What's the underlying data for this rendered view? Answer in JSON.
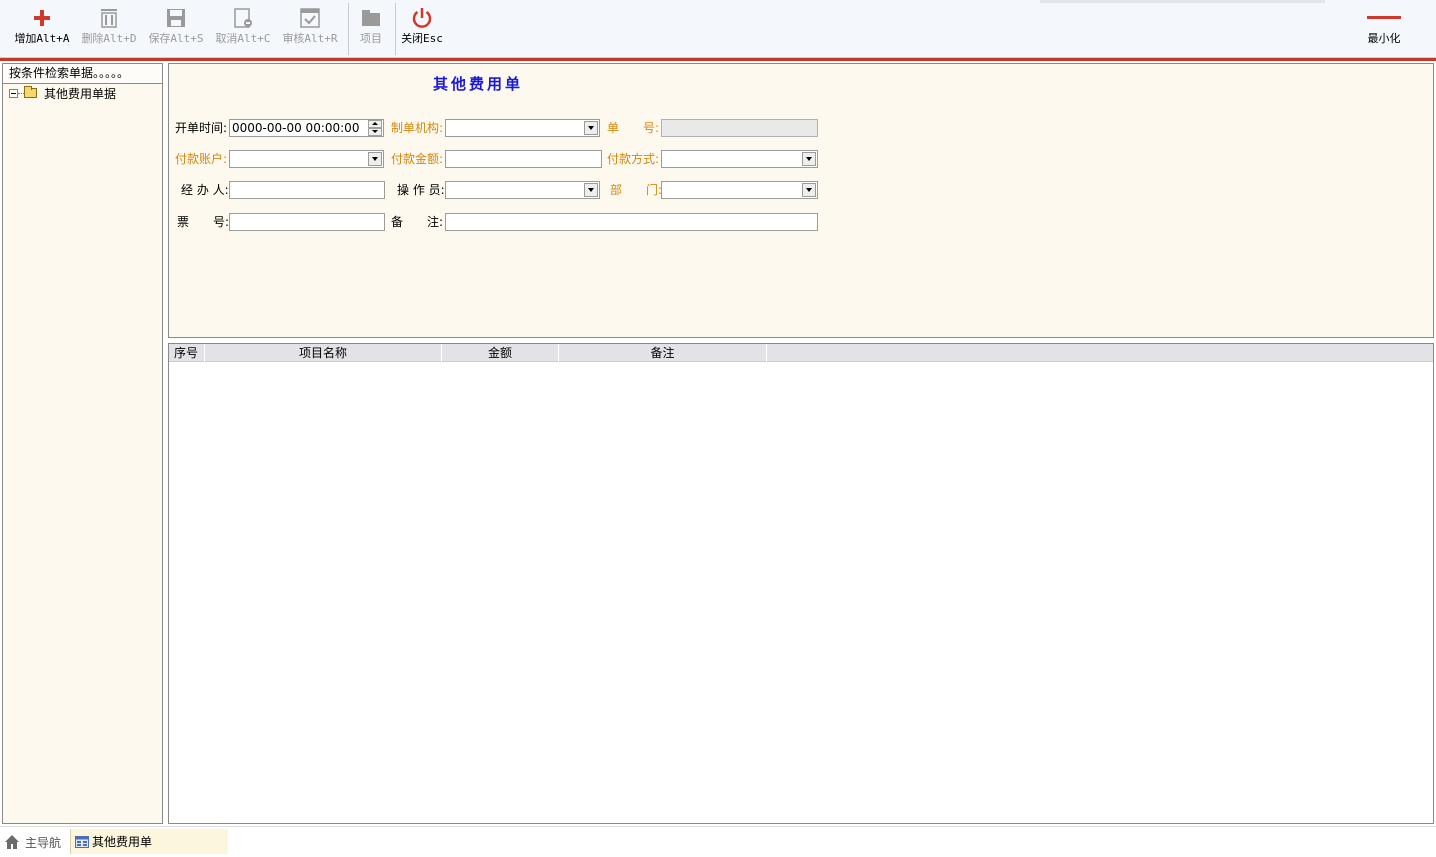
{
  "toolbar": {
    "add": "增加Alt+A",
    "delete": "删除Alt+D",
    "save": "保存Alt+S",
    "cancel": "取消Alt+C",
    "approve": "审核Alt+R",
    "items": "项目",
    "close": "关闭Esc",
    "minimize": "最小化"
  },
  "left_panel": {
    "header": "按条件检索单据。。。。。",
    "tree_root": "其他费用单据"
  },
  "form": {
    "title": "其他费用单",
    "open_time_label": "开单时间:",
    "open_time_value": "0000-00-00 00:00:00",
    "org_label": "制单机构:",
    "org_value": "",
    "doc_no_label": "单　　号:",
    "doc_no_value": "",
    "pay_account_label": "付款账户:",
    "pay_account_value": "",
    "pay_amount_label": "付款金额:",
    "pay_amount_value": "",
    "pay_method_label": "付款方式:",
    "pay_method_value": "",
    "handler_label": "经 办 人:",
    "handler_value": "",
    "operator_label": "操 作 员:",
    "operator_value": "",
    "department_label": "部　　门:",
    "department_value": "",
    "ticket_label": "票　　号:",
    "ticket_value": "",
    "remark_label": "备　　注:",
    "remark_value": ""
  },
  "grid": {
    "columns": [
      "序号",
      "项目名称",
      "金额",
      "备注"
    ],
    "rows": []
  },
  "statusbar": {
    "nav": "主导航",
    "active_tab": "其他费用单"
  },
  "colors": {
    "accent_red": "#c0392b",
    "required_label": "#d4870f",
    "title_blue": "#1a1ad6",
    "panel_bg": "#fdf9ee"
  }
}
